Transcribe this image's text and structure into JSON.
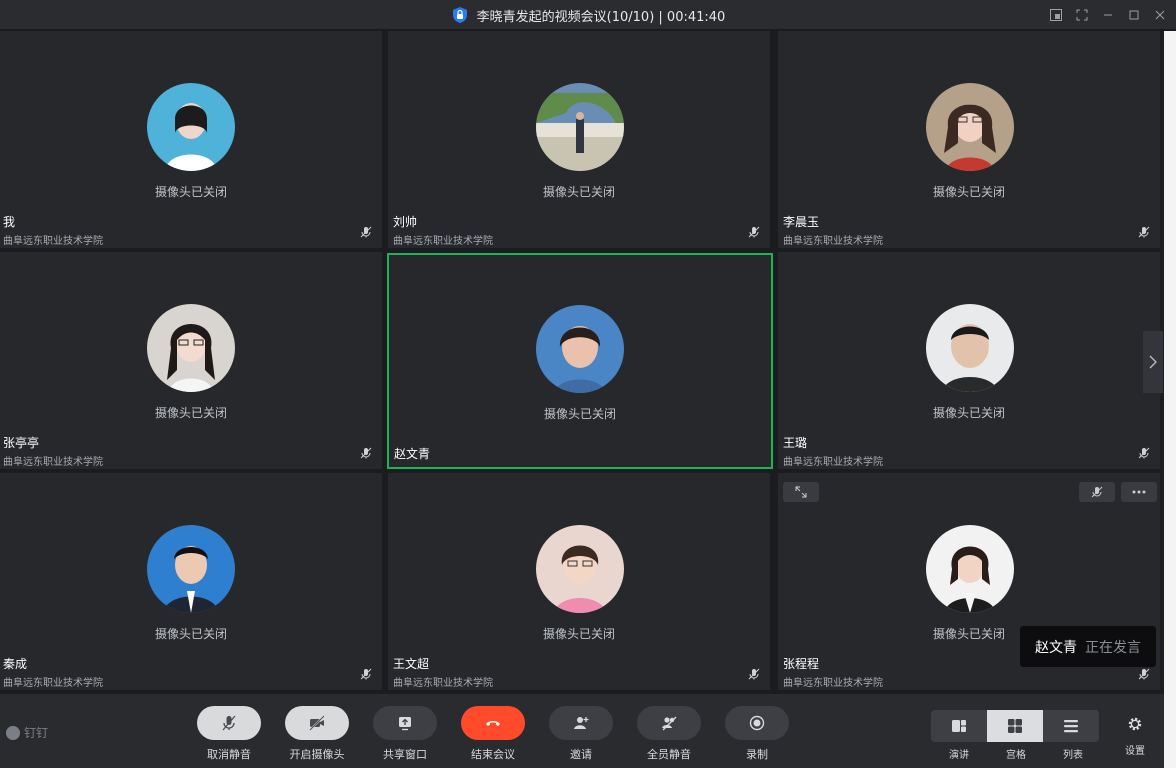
{
  "window": {
    "title": "李晓青发起的视频会议(10/10) | 00:41:40"
  },
  "participants": [
    {
      "name": "我",
      "org": "曲阜远东职业技术学院",
      "camera_status": "摄像头已关闭",
      "avatar_bg": "#4fb3d9",
      "active": false
    },
    {
      "name": "刘帅",
      "org": "曲阜远东职业技术学院",
      "camera_status": "摄像头已关闭",
      "avatar_bg": "#6a8db5",
      "active": false
    },
    {
      "name": "李晨玉",
      "org": "曲阜远东职业技术学院",
      "camera_status": "摄像头已关闭",
      "avatar_bg": "#b5a08a",
      "active": false
    },
    {
      "name": "张亭亭",
      "org": "曲阜远东职业技术学院",
      "camera_status": "摄像头已关闭",
      "avatar_bg": "#d8d4cf",
      "active": false
    },
    {
      "name": "赵文青",
      "org": "",
      "camera_status": "摄像头已关闭",
      "avatar_bg": "#4a86c5",
      "active": true
    },
    {
      "name": "王璐",
      "org": "曲阜远东职业技术学院",
      "camera_status": "摄像头已关闭",
      "avatar_bg": "#e8eaec",
      "active": false
    },
    {
      "name": "秦成",
      "org": "曲阜远东职业技术学院",
      "camera_status": "摄像头已关闭",
      "avatar_bg": "#2f7fd0",
      "active": false
    },
    {
      "name": "王文超",
      "org": "曲阜远东职业技术学院",
      "camera_status": "摄像头已关闭",
      "avatar_bg": "#e9d7cf",
      "active": false
    },
    {
      "name": "张程程",
      "org": "曲阜远东职业技术学院",
      "camera_status": "摄像头已关闭",
      "avatar_bg": "#f2f2f2",
      "active": false
    }
  ],
  "speaking_toast": {
    "name": "赵文青",
    "status": "正在发言"
  },
  "brand": {
    "label": "钉钉"
  },
  "toolbar": {
    "buttons": [
      {
        "label": "取消静音",
        "icon": "mic-muted-icon"
      },
      {
        "label": "开启摄像头",
        "icon": "camera-off-icon"
      },
      {
        "label": "共享窗口",
        "icon": "share-screen-icon"
      },
      {
        "label": "结束会议",
        "icon": "end-call-icon"
      },
      {
        "label": "邀请",
        "icon": "invite-icon"
      },
      {
        "label": "全员静音",
        "icon": "mute-all-icon"
      },
      {
        "label": "录制",
        "icon": "record-icon"
      }
    ],
    "layouts": [
      {
        "label": "演讲",
        "icon": "speaker-layout-icon",
        "selected": false
      },
      {
        "label": "宫格",
        "icon": "grid-layout-icon",
        "selected": true
      },
      {
        "label": "列表",
        "icon": "list-layout-icon",
        "selected": false
      }
    ],
    "settings_label": "设置"
  },
  "colors": {
    "active_border": "#1fb257",
    "end_call": "#ff4b2b",
    "tile_bg": "#27282c"
  }
}
